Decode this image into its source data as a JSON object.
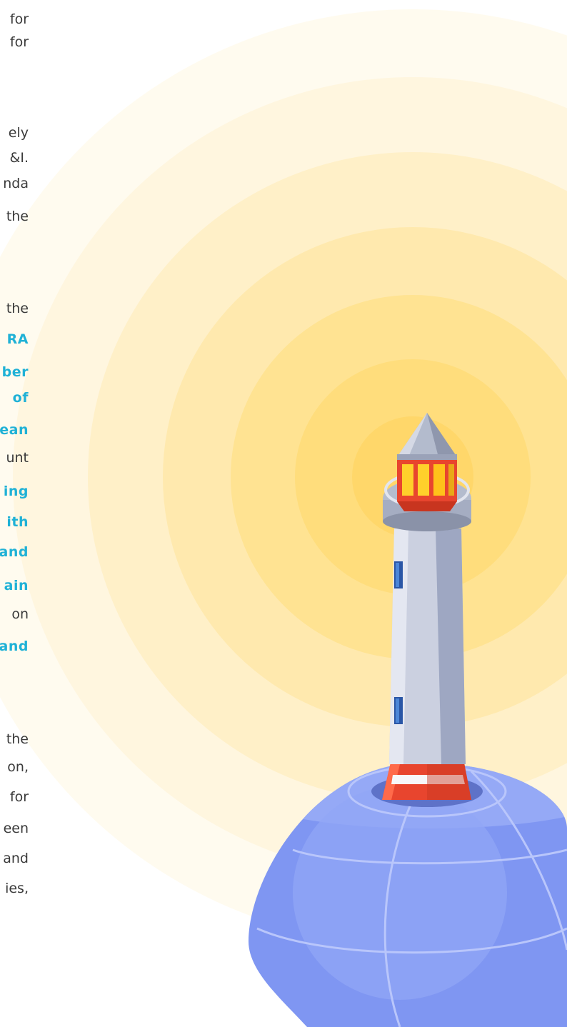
{
  "text_lines": [
    {
      "text": "for",
      "hl": false
    },
    {
      "text": "for",
      "hl": false
    },
    {
      "text": "ely",
      "hl": false
    },
    {
      "text": "&I.",
      "hl": false
    },
    {
      "text": "nda",
      "hl": false
    },
    {
      "text": "the",
      "hl": false
    },
    {
      "text": "the",
      "hl": false
    },
    {
      "text": "RA",
      "hl": true
    },
    {
      "text": "ber",
      "hl": true
    },
    {
      "text": "of",
      "hl": true
    },
    {
      "text": "ean",
      "hl": true
    },
    {
      "text": "unt",
      "hl": false
    },
    {
      "text": "ing",
      "hl": true
    },
    {
      "text": "ith",
      "hl": true
    },
    {
      "text": "and",
      "hl": true
    },
    {
      "text": "ain",
      "hl": true
    },
    {
      "text": "on",
      "hl": false
    },
    {
      "text": "and",
      "hl": true
    },
    {
      "text": "the",
      "hl": false
    },
    {
      "text": "on,",
      "hl": false
    },
    {
      "text": "for",
      "hl": false
    },
    {
      "text": "een",
      "hl": false
    },
    {
      "text": "and",
      "hl": false
    },
    {
      "text": "ies,",
      "hl": false
    }
  ],
  "colors": {
    "body_text": "#3a3a3a",
    "highlight_text": "#1fb1d6",
    "glow_outer": "#fff6df",
    "glow_inner": "#ffe07a",
    "dome": "#7f96f2",
    "tower": "#cbd0e0",
    "stripe": "#e8452e"
  },
  "illustration": {
    "icon": "lighthouse-icon"
  }
}
